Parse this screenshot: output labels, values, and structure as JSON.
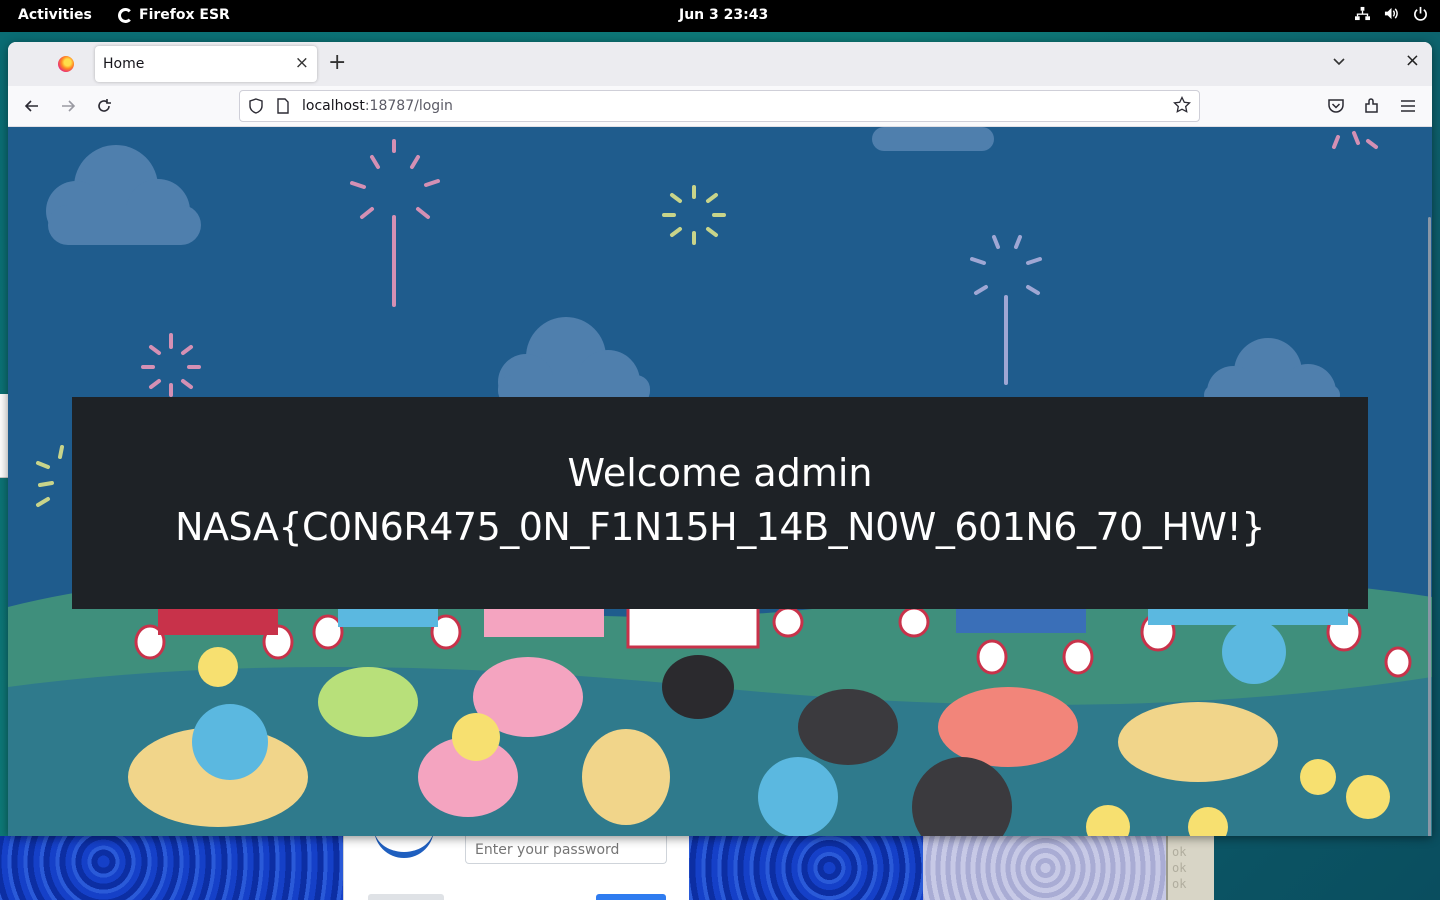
{
  "topbar": {
    "activities": "Activities",
    "app_name": "Firefox ESR",
    "clock": "Jun 3  23:43",
    "tray_icons": [
      "network-icon",
      "volume-icon",
      "power-icon"
    ]
  },
  "browser": {
    "tab_title": "Home",
    "url_host": "localhost",
    "url_rest": ":18787/login",
    "new_tab_symbol": "+",
    "close_symbol": "×"
  },
  "page": {
    "welcome_line": "Welcome admin",
    "flag_line": "NASA{C0N6R475_0N_F1N15H_14B_N0W_601N6_70_HW!}"
  },
  "background": {
    "password_placeholder": "Enter your password",
    "terminal_lines": [
      "ok",
      "ok",
      "ok"
    ]
  },
  "colors": {
    "page_sky": "#1f5c8d",
    "banner_bg": "#1e2226",
    "banner_text": "#ffffff",
    "cloud": "#4f7fad",
    "grass": "#3f8f7c"
  }
}
